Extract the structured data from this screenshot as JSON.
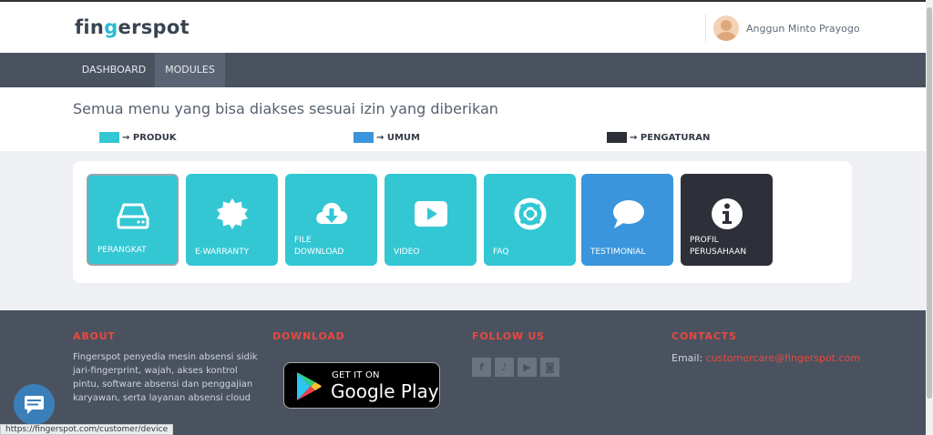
{
  "header": {
    "logo_prefix": "fin",
    "logo_accent": "g",
    "logo_suffix": "erspot",
    "user_name": "Anggun Minto Prayogo"
  },
  "nav": {
    "items": [
      {
        "label": "DASHBOARD"
      },
      {
        "label": "MODULES",
        "active": true
      }
    ]
  },
  "intro": {
    "title": "Semua menu yang bisa diakses sesuai izin yang diberikan",
    "legend": [
      {
        "label": "→ PRODUK",
        "color": "#33c7d4"
      },
      {
        "label": "→ UMUM",
        "color": "#3a95dc"
      },
      {
        "label": "→ PENGATURAN",
        "color": "#2d3038"
      }
    ]
  },
  "modules": [
    {
      "label": "PERANGKAT",
      "icon": "hard-drive-icon",
      "color": "#33c7d4",
      "selected": true
    },
    {
      "label": "E-WARRANTY",
      "icon": "badge-seal-icon",
      "color": "#33c7d4"
    },
    {
      "label": "FILE DOWNLOAD",
      "icon": "cloud-download-icon",
      "color": "#33c7d4"
    },
    {
      "label": "VIDEO",
      "icon": "video-play-icon",
      "color": "#33c7d4"
    },
    {
      "label": "FAQ",
      "icon": "life-ring-icon",
      "color": "#33c7d4"
    },
    {
      "label": "TESTIMONIAL",
      "icon": "speech-bubble-icon",
      "color": "#3a95dc"
    },
    {
      "label": "PROFIL PERUSAHAAN",
      "icon": "info-circle-icon",
      "color": "#2d3038"
    }
  ],
  "footer": {
    "about_heading": "ABOUT",
    "about_text": "Fingerspot penyedia mesin absensi sidik jari-fingerprint, wajah, akses kontrol pintu, software absensi dan penggajian karyawan, serta layanan absensi cloud",
    "download_heading": "DOWNLOAD",
    "gplay_small": "GET IT ON",
    "gplay_big": "Google Play",
    "follow_heading": "FOLLOW US",
    "social": [
      "facebook-icon",
      "tiktok-icon",
      "youtube-icon",
      "instagram-icon"
    ],
    "contacts_heading": "CONTACTS",
    "email_label": "Email: ",
    "email": "customercare@fingerspot.com"
  },
  "status_url": "https://fingerspot.com/customer/device"
}
